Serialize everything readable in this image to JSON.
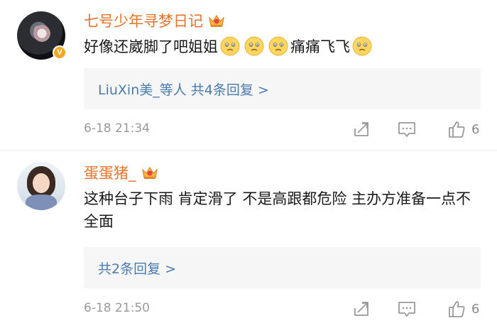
{
  "comments": [
    {
      "username": "七号少年寻梦日记",
      "verified_badge": "V",
      "text_parts": [
        "好像还崴脚了吧姐姐",
        "痛痛飞飞"
      ],
      "replies_label": "LiuXin美_等人 共4条回复 >",
      "time": "6-18 21:34",
      "likes": "6"
    },
    {
      "username": "蛋蛋猪_",
      "text": "这种台子下雨 肯定滑了 不是高跟都危险 主办方准备一点不全面",
      "replies_label": "共2条回复 >",
      "time": "6-18 21:50",
      "likes": "6"
    }
  ],
  "icons": {
    "crown": "crown-badge-icon",
    "emoji": "worried-face-emoji",
    "share": "share-icon",
    "reply": "comment-icon",
    "like": "thumbs-up-icon"
  },
  "colors": {
    "username": "#e8732b",
    "link": "#4a7bb0",
    "muted": "#9a9a9a",
    "reply_bg": "#f6f6f6",
    "badge": "#f5a623"
  }
}
